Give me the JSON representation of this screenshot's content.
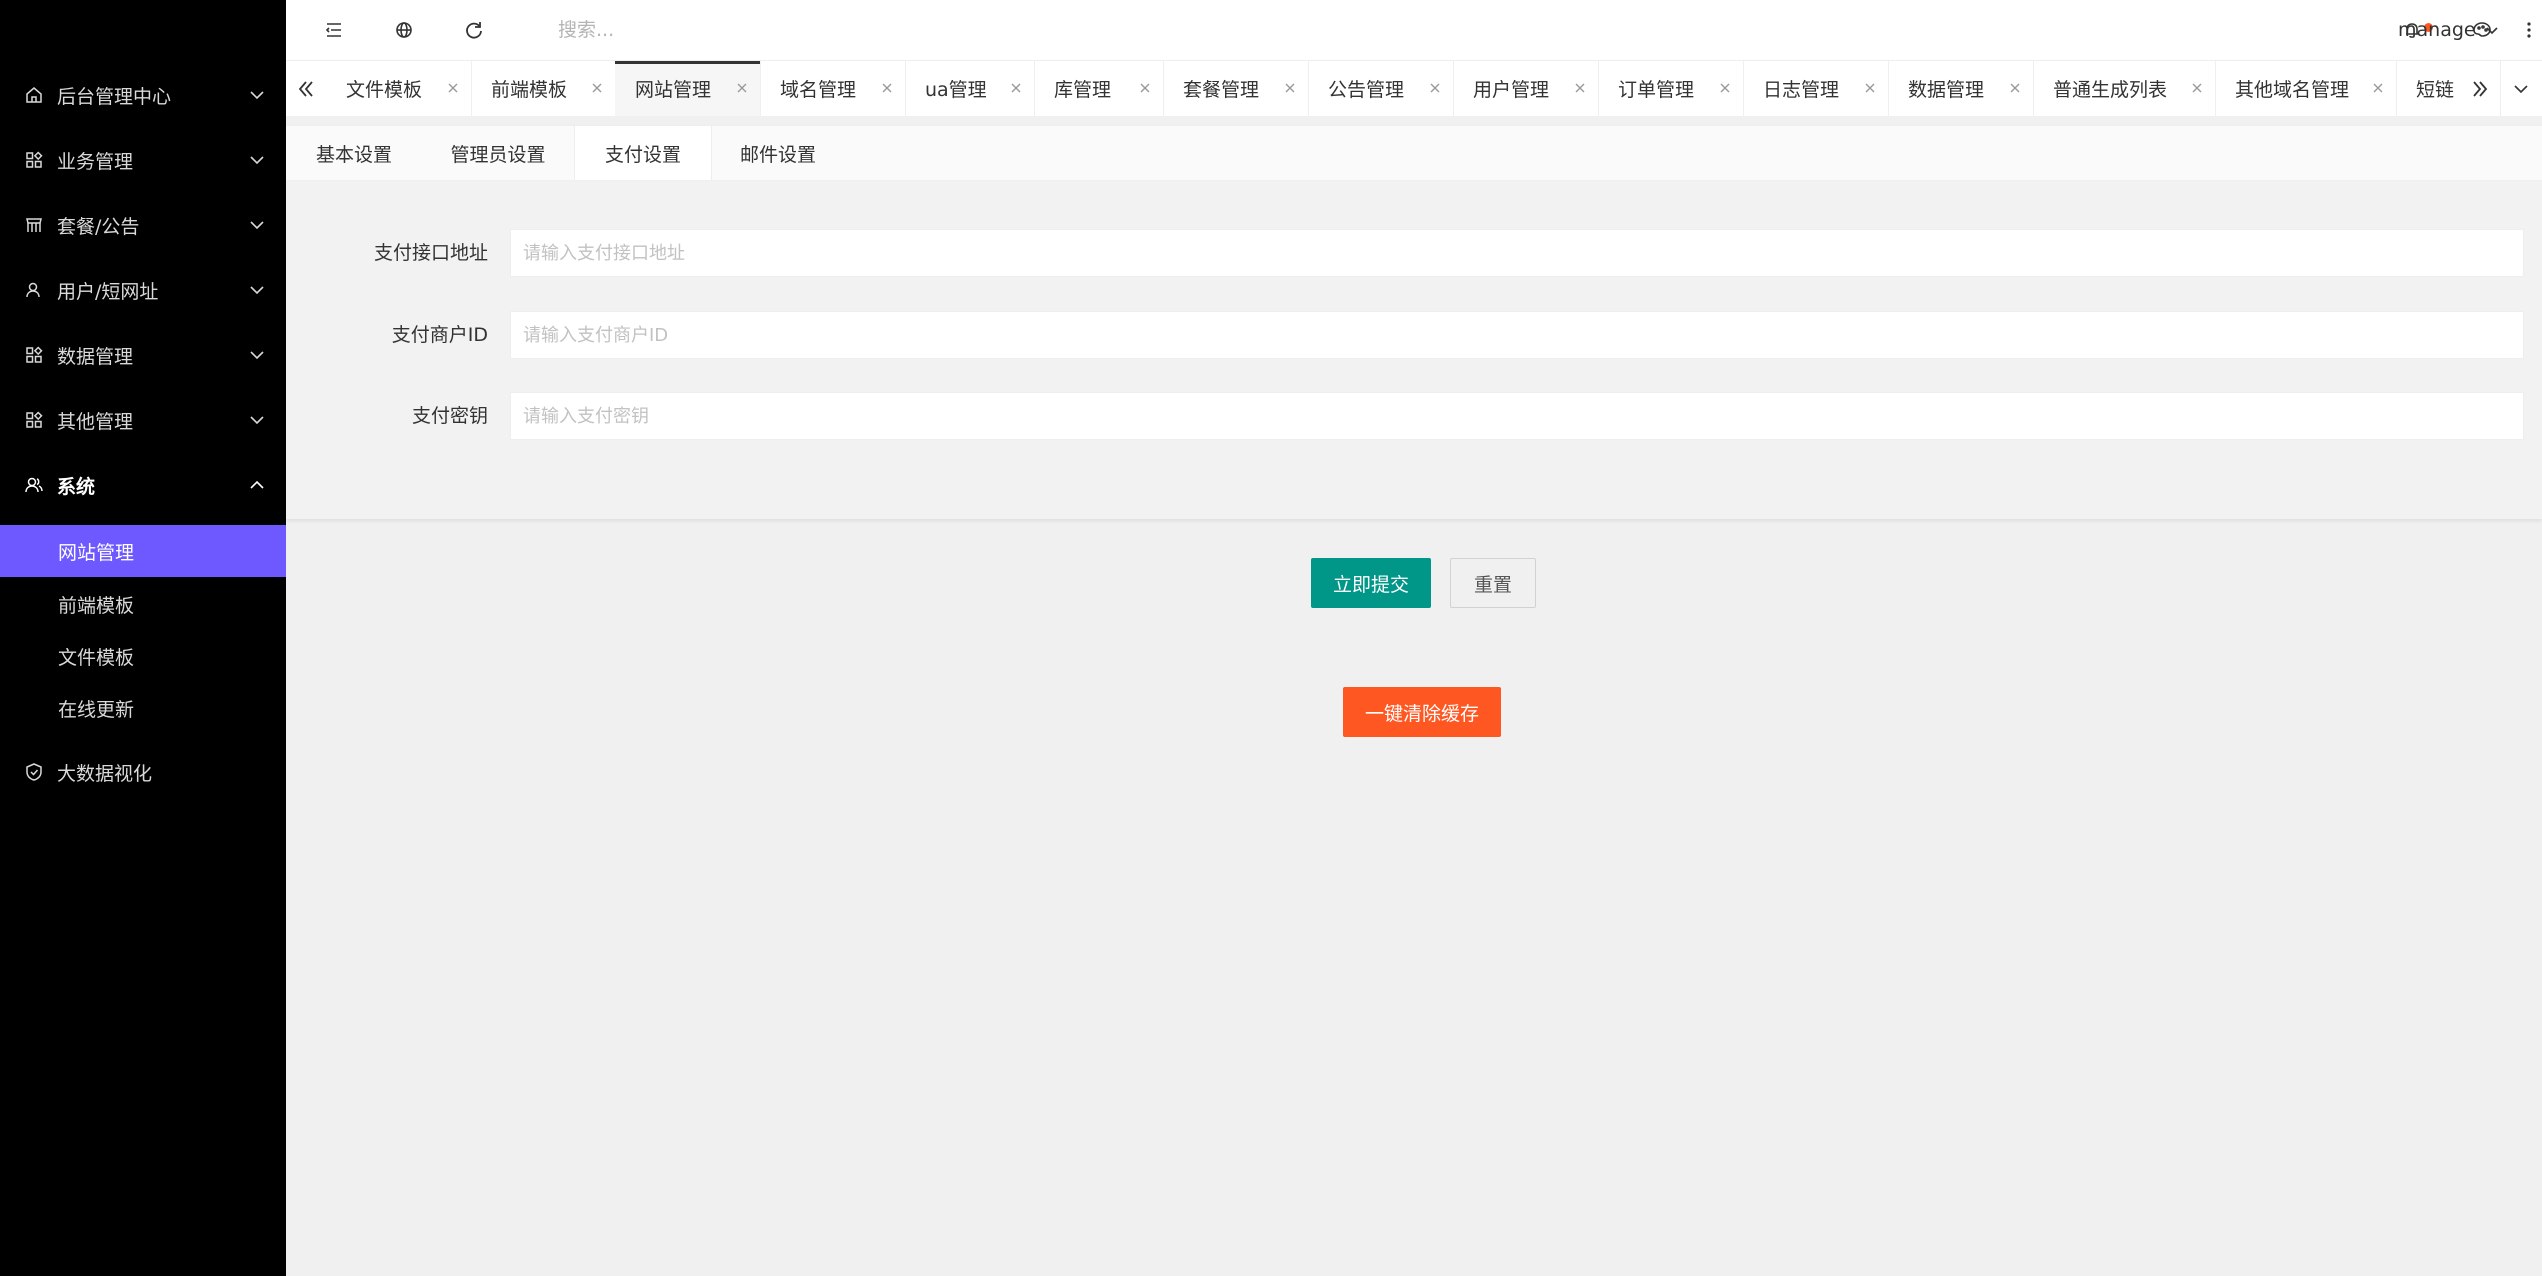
{
  "sidebar": {
    "items": [
      {
        "label": "后台管理中心",
        "icon": "home-icon"
      },
      {
        "label": "业务管理",
        "icon": "apps-icon"
      },
      {
        "label": "套餐/公告",
        "icon": "store-icon"
      },
      {
        "label": "用户/短网址",
        "icon": "user-icon"
      },
      {
        "label": "数据管理",
        "icon": "apps-icon"
      },
      {
        "label": "其他管理",
        "icon": "apps-icon"
      },
      {
        "label": "系统",
        "icon": "user-group-icon"
      }
    ],
    "system_children": [
      {
        "label": "网站管理",
        "active": true
      },
      {
        "label": "前端模板"
      },
      {
        "label": "文件模板"
      },
      {
        "label": "在线更新"
      }
    ],
    "bigdata": {
      "label": "大数据视化",
      "icon": "shield-icon"
    }
  },
  "header": {
    "search_placeholder": "搜索...",
    "username": "manage",
    "notification_dot_color": "#ff5722"
  },
  "tabs": [
    {
      "label": "文件模板"
    },
    {
      "label": "前端模板"
    },
    {
      "label": "网站管理",
      "active": true
    },
    {
      "label": "域名管理"
    },
    {
      "label": "ua管理"
    },
    {
      "label": "库管理"
    },
    {
      "label": "套餐管理"
    },
    {
      "label": "公告管理"
    },
    {
      "label": "用户管理"
    },
    {
      "label": "订单管理"
    },
    {
      "label": "日志管理"
    },
    {
      "label": "数据管理"
    },
    {
      "label": "普通生成列表"
    },
    {
      "label": "其他域名管理"
    },
    {
      "label": "短链"
    }
  ],
  "settings_tabs": [
    {
      "label": "基本设置"
    },
    {
      "label": "管理员设置"
    },
    {
      "label": "支付设置",
      "active": true
    },
    {
      "label": "邮件设置"
    }
  ],
  "form": {
    "fields": [
      {
        "label": "支付接口地址",
        "placeholder": "请输入支付接口地址",
        "value": ""
      },
      {
        "label": "支付商户ID",
        "placeholder": "请输入支付商户ID",
        "value": ""
      },
      {
        "label": "支付密钥",
        "placeholder": "请输入支付密钥",
        "value": ""
      }
    ],
    "submit_label": "立即提交",
    "reset_label": "重置",
    "clear_cache_label": "一键清除缓存"
  },
  "colors": {
    "sidebar_bg": "#000000",
    "active_menu": "#6D59FF",
    "submit": "#009688",
    "danger": "#ff5722"
  }
}
